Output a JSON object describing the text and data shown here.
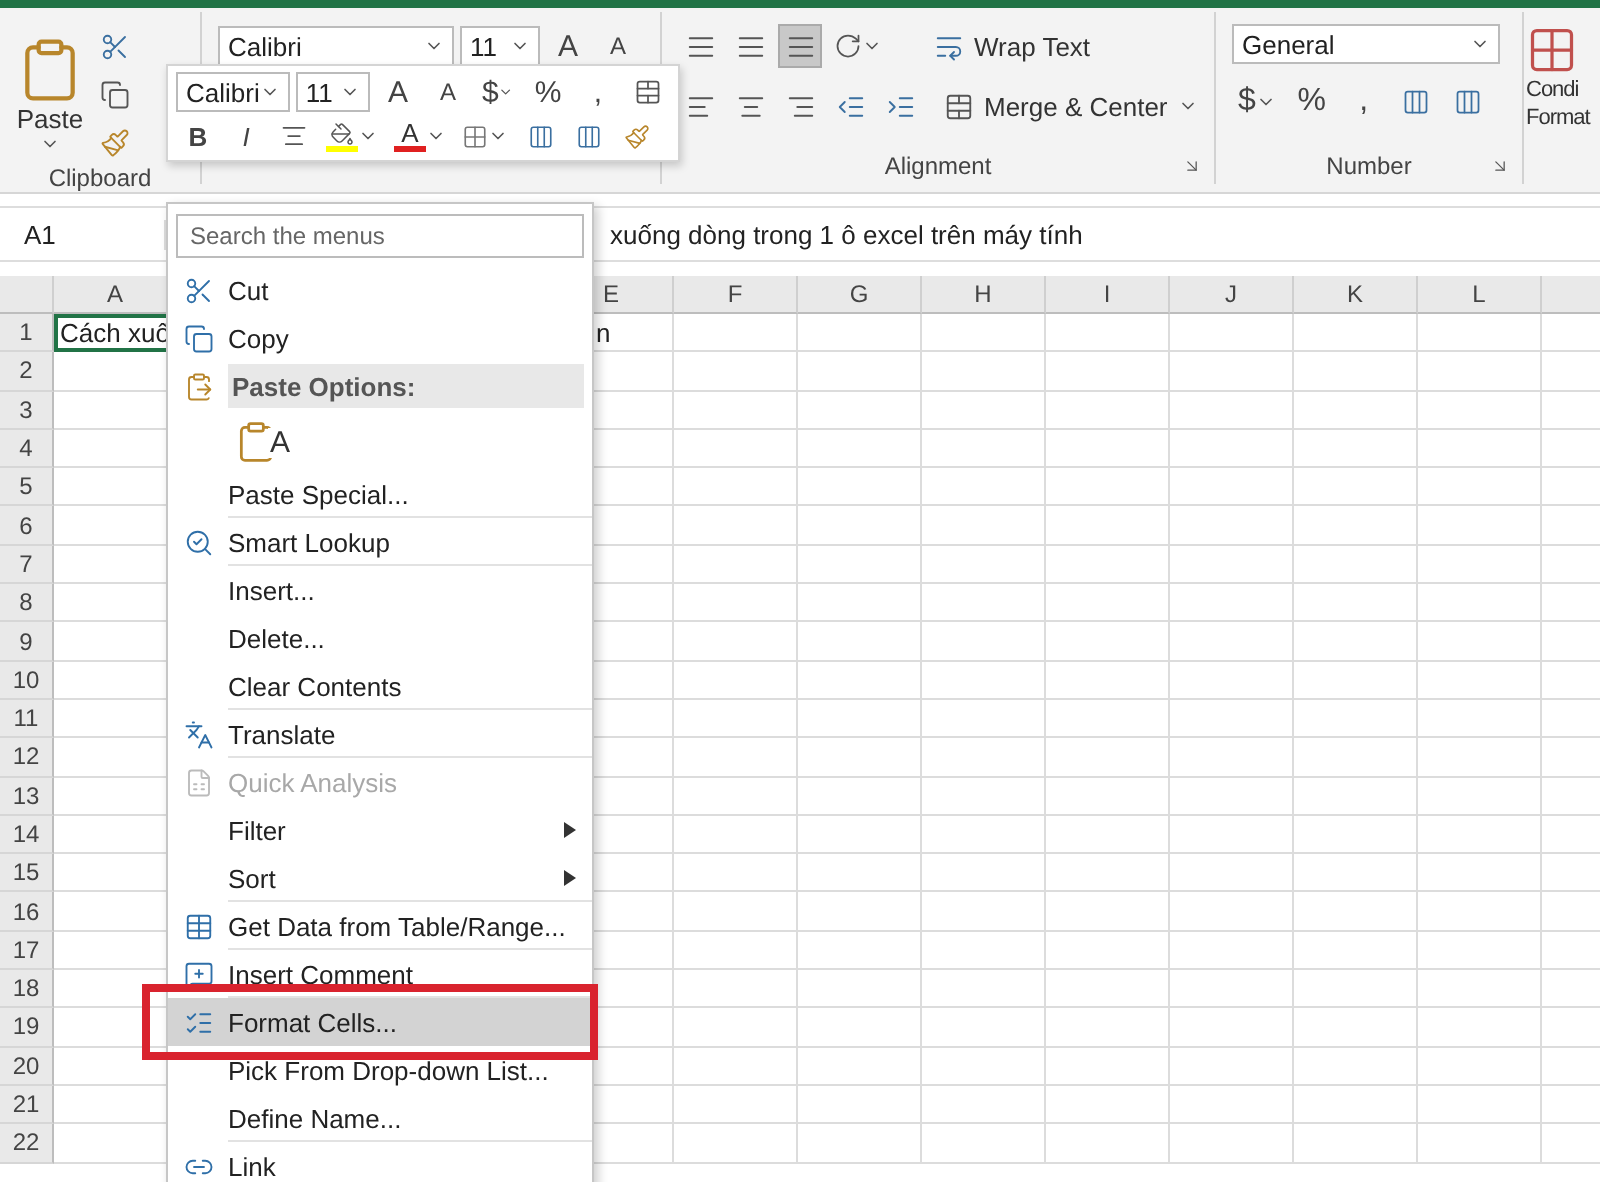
{
  "ribbon": {
    "clipboard": {
      "paste_label": "Paste",
      "group_label": "Clipboard"
    },
    "font": {
      "font_name": "Calibri",
      "font_size": "11",
      "grow_label": "A",
      "shrink_label": "A"
    },
    "alignment": {
      "align_buttons": [
        {
          "selected": false
        },
        {
          "selected": false
        },
        {
          "selected": true
        }
      ],
      "wrap_text": "Wrap Text",
      "merge_center": "Merge & Center",
      "group_label": "Alignment"
    },
    "number": {
      "format": "General",
      "currency": "$",
      "percent": "%",
      "comma": ",",
      "group_label": "Number"
    },
    "styles": {
      "label_line_1": "Condi",
      "label_line_2": "Format"
    }
  },
  "mini_toolbar": {
    "font_name": "Calibri",
    "font_size": "11",
    "grow_label": "A",
    "shrink_label": "A",
    "currency": "$",
    "percent": "%",
    "comma": ",",
    "bold": "B",
    "italic": "I",
    "font_color_label": "A"
  },
  "formula_bar": {
    "name_box": "A1",
    "formula": "xuống dòng trong 1 ô excel trên máy tính"
  },
  "sheet": {
    "columns": [
      "A",
      "E",
      "F",
      "G",
      "H",
      "I",
      "J",
      "K",
      "L"
    ],
    "rows": [
      "1",
      "2",
      "3",
      "4",
      "5",
      "6",
      "7",
      "8",
      "9",
      "10",
      "11",
      "12",
      "13",
      "14",
      "15",
      "16",
      "17",
      "18",
      "19",
      "20",
      "21",
      "22"
    ],
    "cells": [
      {
        "text": "Cách xuố",
        "selected": true
      },
      {
        "text": "n",
        "selected": false
      }
    ]
  },
  "context_menu": {
    "search": {
      "placeholder": "Search the menus"
    },
    "items": [
      {
        "kind": "command",
        "label": "Cut",
        "disabled": false,
        "submenu": false,
        "separator_after": false,
        "selected": false,
        "boxed": false
      },
      {
        "kind": "command",
        "label": "Copy",
        "disabled": false,
        "submenu": false,
        "separator_after": false,
        "selected": false,
        "boxed": false
      },
      {
        "kind": "header",
        "label": "Paste Options:"
      },
      {
        "kind": "paste-icons",
        "options": [
          {
            "letter": "A"
          }
        ]
      },
      {
        "kind": "command",
        "label": "Paste Special...",
        "disabled": false,
        "submenu": false,
        "separator_after": true,
        "selected": false,
        "boxed": false
      },
      {
        "kind": "command",
        "label": "Smart Lookup",
        "disabled": false,
        "submenu": false,
        "separator_after": true,
        "selected": false,
        "boxed": false
      },
      {
        "kind": "command",
        "label": "Insert...",
        "disabled": false,
        "submenu": false,
        "separator_after": false,
        "selected": false,
        "boxed": false
      },
      {
        "kind": "command",
        "label": "Delete...",
        "disabled": false,
        "submenu": false,
        "separator_after": false,
        "selected": false,
        "boxed": false
      },
      {
        "kind": "command",
        "label": "Clear Contents",
        "disabled": false,
        "submenu": false,
        "separator_after": true,
        "selected": false,
        "boxed": false
      },
      {
        "kind": "command",
        "label": "Translate",
        "disabled": false,
        "submenu": false,
        "separator_after": true,
        "selected": false,
        "boxed": false
      },
      {
        "kind": "command",
        "label": "Quick Analysis",
        "disabled": true,
        "submenu": false,
        "separator_after": false,
        "selected": false,
        "boxed": false
      },
      {
        "kind": "command",
        "label": "Filter",
        "disabled": false,
        "submenu": true,
        "separator_after": false,
        "selected": false,
        "boxed": false
      },
      {
        "kind": "command",
        "label": "Sort",
        "disabled": false,
        "submenu": true,
        "separator_after": true,
        "selected": false,
        "boxed": false
      },
      {
        "kind": "command",
        "label": "Get Data from Table/Range...",
        "disabled": false,
        "submenu": false,
        "separator_after": true,
        "selected": false,
        "boxed": false
      },
      {
        "kind": "command",
        "label": "Insert Comment",
        "disabled": false,
        "submenu": false,
        "separator_after": true,
        "selected": false,
        "boxed": false
      },
      {
        "kind": "command",
        "label": "Format Cells...",
        "disabled": false,
        "submenu": false,
        "separator_after": false,
        "selected": true,
        "boxed": true
      },
      {
        "kind": "command",
        "label": "Pick From Drop-down List...",
        "disabled": false,
        "submenu": false,
        "separator_after": false,
        "selected": false,
        "boxed": false
      },
      {
        "kind": "command",
        "label": "Define Name...",
        "disabled": false,
        "submenu": false,
        "separator_after": true,
        "selected": false,
        "boxed": false
      },
      {
        "kind": "command",
        "label": "Link",
        "disabled": false,
        "submenu": false,
        "selected": false,
        "boxed": false
      }
    ]
  }
}
